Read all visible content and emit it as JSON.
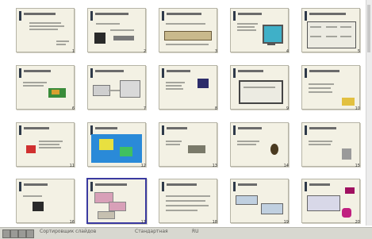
{
  "slides": [
    {
      "number": "1",
      "title_w": 40,
      "art": "text"
    },
    {
      "number": "2",
      "title_w": 42,
      "art": "dark-monitor"
    },
    {
      "number": "3",
      "title_w": 44,
      "art": "network"
    },
    {
      "number": "4",
      "title_w": 30,
      "art": "cyan-monitor"
    },
    {
      "number": "5",
      "title_w": 46,
      "art": "blueprint"
    },
    {
      "number": "6",
      "title_w": 34,
      "art": "books"
    },
    {
      "number": "7",
      "title_w": 36,
      "art": "connect"
    },
    {
      "number": "8",
      "title_w": 30,
      "art": "monitor"
    },
    {
      "number": "9",
      "title_w": 32,
      "art": "laptop"
    },
    {
      "number": "10",
      "title_w": 38,
      "art": "yellow"
    },
    {
      "number": "11",
      "title_w": 32,
      "art": "red-item"
    },
    {
      "number": "12",
      "title_w": 28,
      "art": "colorful"
    },
    {
      "number": "13",
      "title_w": 26,
      "art": "tools"
    },
    {
      "number": "14",
      "title_w": 30,
      "art": "mask"
    },
    {
      "number": "15",
      "title_w": 34,
      "art": "figure"
    },
    {
      "number": "16",
      "title_w": 30,
      "art": "dark-box"
    },
    {
      "number": "17",
      "title_w": 40,
      "art": "flow-pink",
      "selected": true
    },
    {
      "number": "18",
      "title_w": 38,
      "art": "text-lines"
    },
    {
      "number": "19",
      "title_w": 24,
      "art": "tables"
    },
    {
      "number": "20",
      "title_w": 26,
      "art": "pink-star"
    }
  ],
  "status": {
    "left_text": "Сортировщик слайдов",
    "mid_text": "Стандартная",
    "right_text": "RU"
  }
}
